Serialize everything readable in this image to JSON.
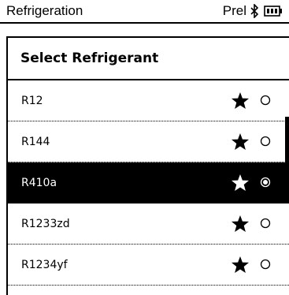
{
  "status_bar": {
    "app_title": "Refrigeration",
    "status_text": "Prel"
  },
  "panel": {
    "title": "Select Refrigerant"
  },
  "refrigerants": [
    {
      "label": "R12",
      "favorite": true,
      "selected": false
    },
    {
      "label": "R144",
      "favorite": true,
      "selected": false
    },
    {
      "label": "R410a",
      "favorite": true,
      "selected": true
    },
    {
      "label": "R1233zd",
      "favorite": true,
      "selected": false
    },
    {
      "label": "R1234yf",
      "favorite": true,
      "selected": false
    }
  ]
}
